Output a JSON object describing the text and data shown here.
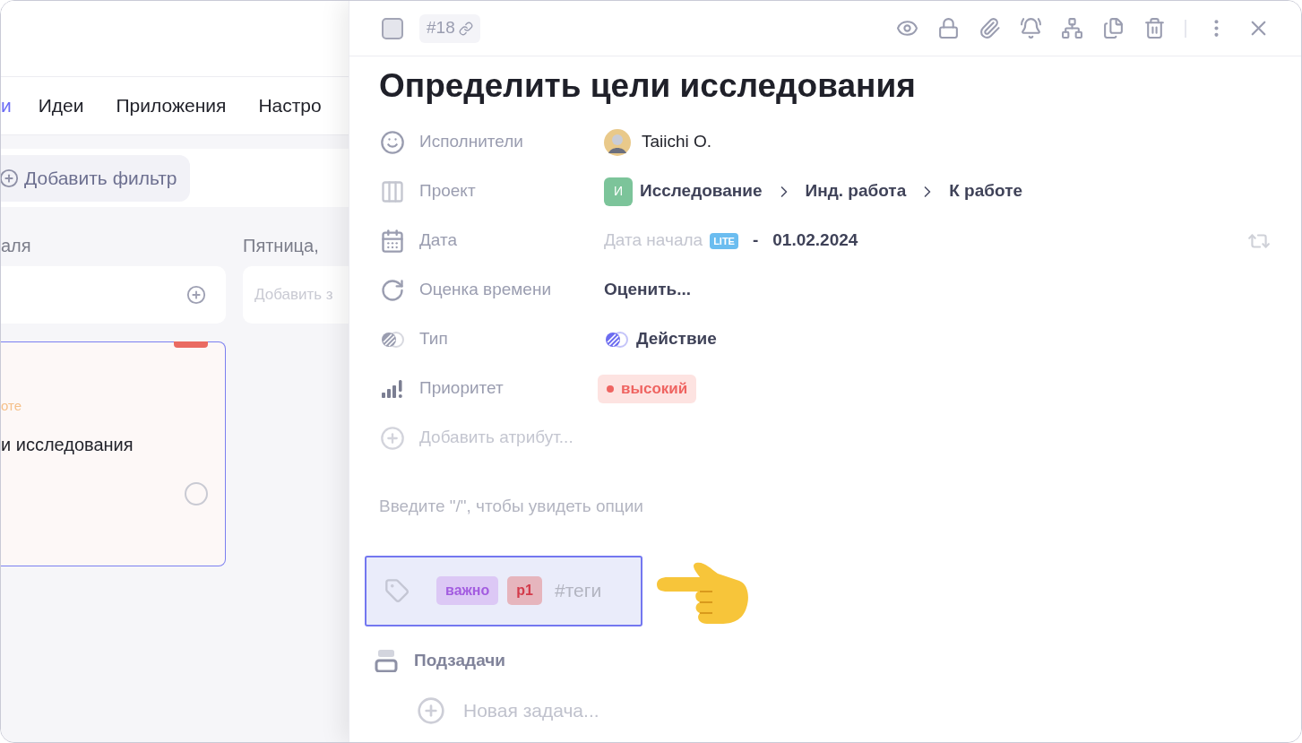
{
  "board": {
    "tabs": [
      {
        "label": "и",
        "selected": true
      },
      {
        "label": "Идеи",
        "selected": false
      },
      {
        "label": "Приложения",
        "selected": false
      },
      {
        "label": "Настро",
        "selected": false
      }
    ],
    "filter_button": "Добавить фильтр",
    "columns": [
      {
        "header": "аля",
        "card": {
          "status": "оте",
          "title": "и исследования",
          "checked": false
        }
      },
      {
        "header": "Пятница,",
        "add_placeholder": "Добавить з"
      }
    ]
  },
  "task": {
    "id": "#18",
    "title": "Определить цели исследования",
    "attributes": [
      {
        "kind": "people",
        "label": "Исполнители",
        "value": "Taiichi O."
      },
      {
        "kind": "project",
        "label": "Проект",
        "badge": "И",
        "color": "#7cc49a",
        "path": [
          "Исследование",
          "Инд. работа",
          "К работе"
        ]
      },
      {
        "kind": "date",
        "label": "Дата",
        "start_placeholder": "Дата начала",
        "badge": "LITE",
        "separator": "-",
        "end": "01.02.2024"
      },
      {
        "kind": "estimate",
        "label": "Оценка времени",
        "value": "Оценить..."
      },
      {
        "kind": "type",
        "label": "Тип",
        "value": "Действие"
      },
      {
        "kind": "priority",
        "label": "Приоритет",
        "value": "высокий",
        "color": "#ef6461"
      }
    ],
    "add_attribute": "Добавить атрибут...",
    "editor_placeholder": "Введите \"/\", чтобы увидеть опции",
    "tags": [
      {
        "label": "важно",
        "color": "#dcc8f5"
      },
      {
        "label": "p1",
        "color": "#e6b5bd"
      }
    ],
    "tag_placeholder": "#теги",
    "subtasks": {
      "label": "Подзадачи",
      "new_task": "Новая задача..."
    }
  }
}
